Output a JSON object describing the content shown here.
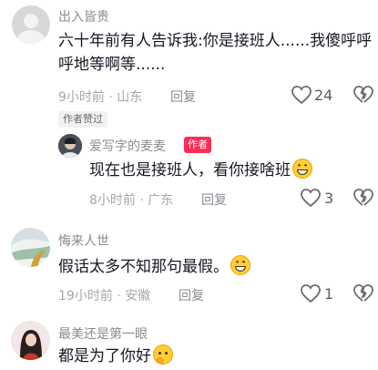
{
  "comments": [
    {
      "username": "出入皆贵",
      "text": "六十年前有人告诉我:你是接班人......我傻呼呼呼地等啊等......",
      "time": "9小时前",
      "location": "山东",
      "reply_label": "回复",
      "likes": "24",
      "author_liked_badge": "作者赞过",
      "replies": [
        {
          "username": "爱写字的麦麦",
          "author_badge": "作者",
          "text": "现在也是接班人，看你接啥班",
          "time": "8小时前",
          "location": "广东",
          "reply_label": "回复",
          "likes": "3"
        }
      ]
    },
    {
      "username": "悔来人世",
      "text": "假话太多不知那句最假。",
      "time": "19小时前",
      "location": "安徽",
      "reply_label": "回复",
      "likes": "1"
    },
    {
      "username": "最美还是第一眼",
      "text": "都是为了你好"
    }
  ],
  "separator": "·",
  "icons": {
    "like": "heart-icon",
    "dislike": "broken-heart-icon",
    "emoji_grin": "grinning-emoji-icon",
    "emoji_think": "thinking-emoji-icon"
  }
}
